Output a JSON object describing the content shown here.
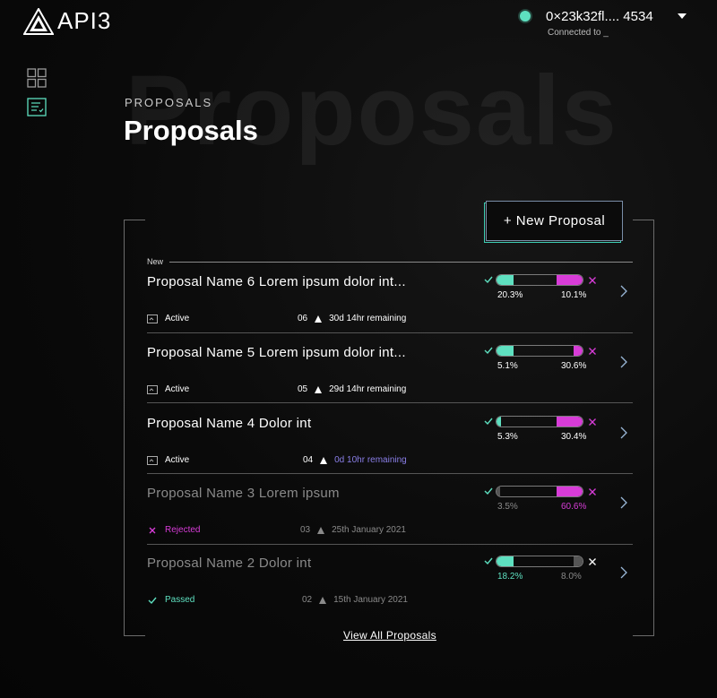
{
  "brand": {
    "name": "API3"
  },
  "wallet": {
    "address": "0×23k32fl.... 4534",
    "connected_to": "Connected to _",
    "status_color": "#5ee0c0"
  },
  "sidebar": {
    "items": [
      {
        "icon": "grid-icon"
      },
      {
        "icon": "list-icon",
        "active": true
      }
    ]
  },
  "header": {
    "background_title": "Proposals",
    "eyebrow": "PROPOSALS",
    "title": "Proposals"
  },
  "new_proposal_label": "+ New Proposal",
  "section_label": "New",
  "colors": {
    "accent_teal": "#5ee0c0",
    "accent_magenta": "#d83cd8",
    "muted": "#8a8a8a",
    "purple_remaining": "#8a7fe8"
  },
  "proposals": [
    {
      "title": "Proposal Name 6 Lorem ipsum dolor int...",
      "status": "Active",
      "number": "06",
      "time": "30d 14hr remaining",
      "for_pct_label": "20.3%",
      "against_pct_label": "10.1%",
      "for_fill": 0.203,
      "against_fill": 0.3
    },
    {
      "title": "Proposal Name 5 Lorem ipsum dolor int...",
      "status": "Active",
      "number": "05",
      "time": "29d 14hr remaining",
      "for_pct_label": "5.1%",
      "against_pct_label": "30.6%",
      "for_fill": 0.2,
      "against_fill": 0.1
    },
    {
      "title": "Proposal Name 4 Dolor int",
      "status": "Active",
      "number": "04",
      "time": "0d 10hr remaining",
      "for_pct_label": "5.3%",
      "against_pct_label": "30.4%",
      "for_fill": 0.05,
      "against_fill": 0.3
    },
    {
      "title": "Proposal Name 3 Lorem ipsum",
      "status": "Rejected",
      "number": "03",
      "time": "25th January 2021",
      "for_pct_label": "3.5%",
      "against_pct_label": "60.6%",
      "for_fill": 0.04,
      "against_fill": 0.3
    },
    {
      "title": "Proposal Name 2 Dolor int",
      "status": "Passed",
      "number": "02",
      "time": "15th January 2021",
      "for_pct_label": "18.2%",
      "against_pct_label": "8.0%",
      "for_fill": 0.2,
      "against_fill": 0.1
    }
  ],
  "view_all_label": "View All Proposals"
}
